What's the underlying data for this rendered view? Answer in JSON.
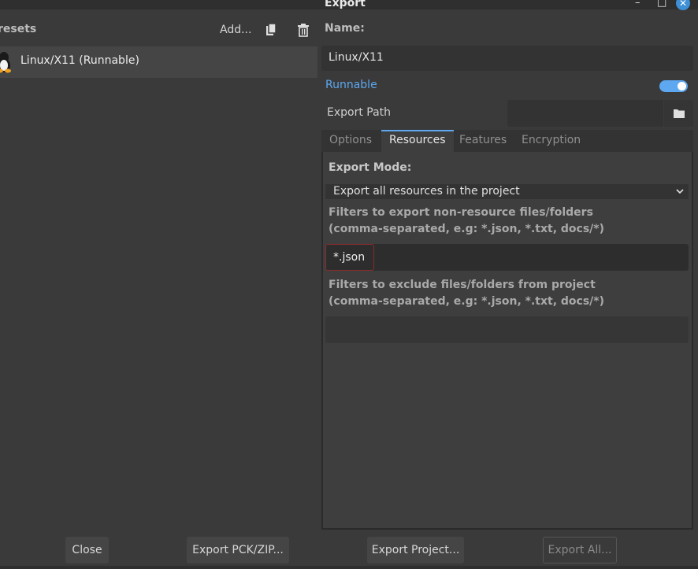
{
  "window": {
    "title": "Export"
  },
  "presets": {
    "label": "resets",
    "add_label": "Add...",
    "items": [
      {
        "label": "Linux/X11 (Runnable)"
      }
    ]
  },
  "preset_detail": {
    "name_label": "Name:",
    "name_value": "Linux/X11",
    "runnable_label": "Runnable",
    "runnable": true,
    "export_path_label": "Export Path",
    "export_path_value": ""
  },
  "tabs": [
    {
      "label": "Options"
    },
    {
      "label": "Resources"
    },
    {
      "label": "Features"
    },
    {
      "label": "Encryption"
    }
  ],
  "active_tab": "Resources",
  "resources": {
    "export_mode_label": "Export Mode:",
    "export_mode_value": "Export all resources in the project",
    "include_filters_label_line1": "Filters to export non-resource files/folders",
    "include_filters_label_line2": "(comma-separated, e.g: *.json, *.txt, docs/*)",
    "include_filters_value": "*.json",
    "exclude_filters_label_line1": "Filters to exclude files/folders from project",
    "exclude_filters_label_line2": "(comma-separated, e.g: *.json, *.txt, docs/*)",
    "exclude_filters_value": ""
  },
  "buttons": {
    "close": "Close",
    "export_pck_zip": "Export PCK/ZIP...",
    "export_project": "Export Project...",
    "export_all": "Export All..."
  },
  "colors": {
    "accent": "#5da8f0",
    "background": "#3a3a3a",
    "highlight_border": "#8a2a2a"
  }
}
